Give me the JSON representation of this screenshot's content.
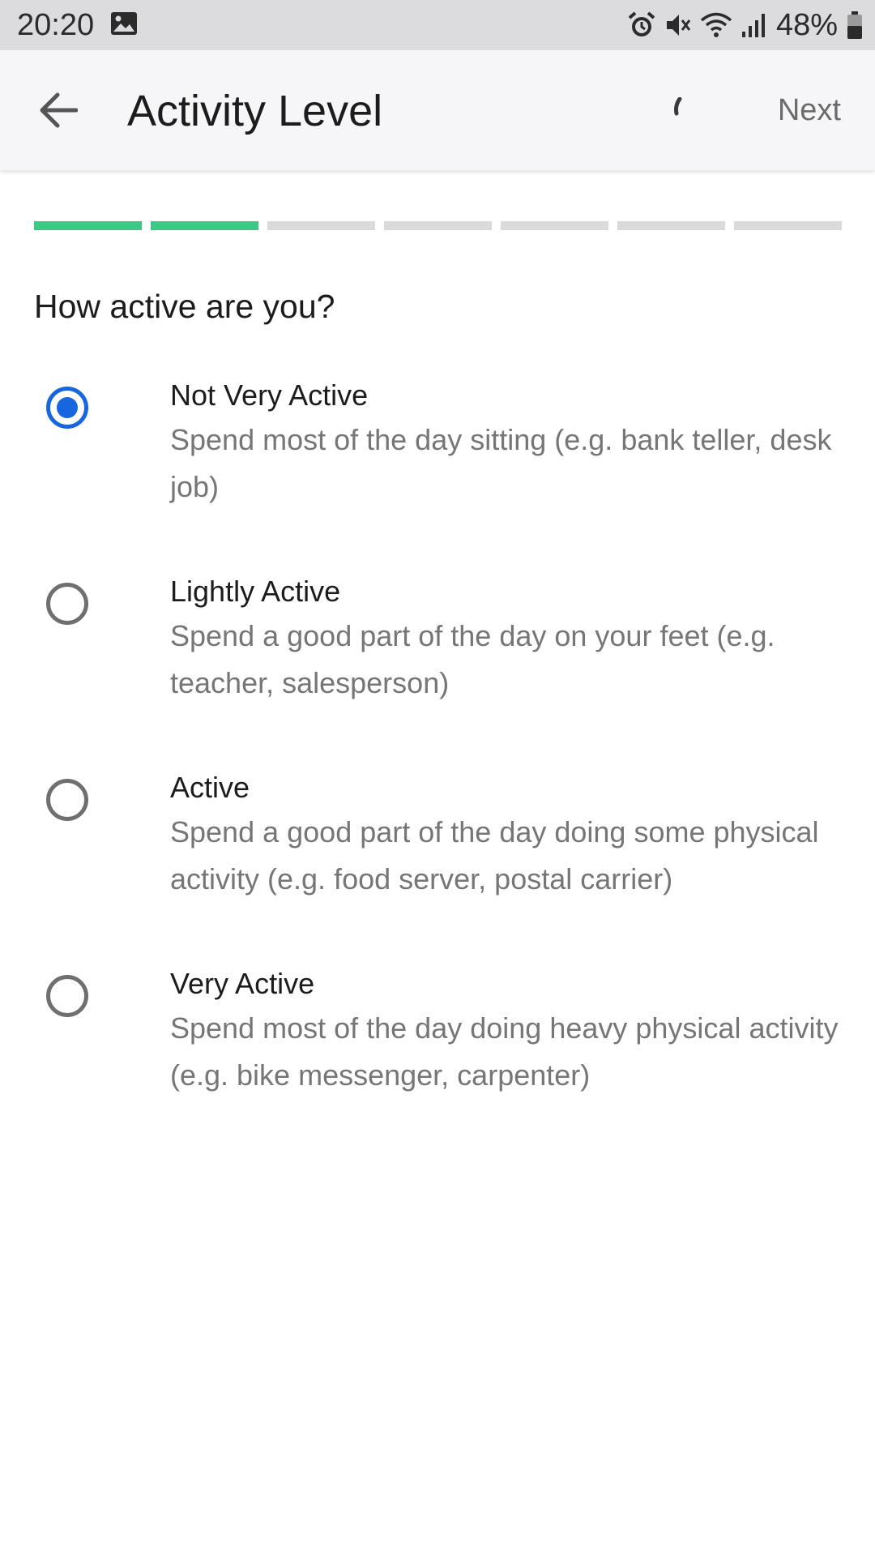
{
  "status_bar": {
    "time": "20:20",
    "battery": "48%",
    "icons": [
      "gallery-icon",
      "alarm-icon",
      "mute-icon",
      "wifi-icon",
      "signal-icon",
      "battery-icon"
    ]
  },
  "app_bar": {
    "title": "Activity Level",
    "next_label": "Next"
  },
  "progress": {
    "total_steps": 7,
    "completed_steps": 2,
    "done_color": "#3ec886",
    "pending_color": "#dadada"
  },
  "question": "How active are you?",
  "options": [
    {
      "title": "Not Very Active",
      "description": "Spend most of the day sitting (e.g. bank teller, desk job)",
      "selected": true
    },
    {
      "title": "Lightly Active",
      "description": "Spend a good part of the day on your feet (e.g. teacher, salesperson)",
      "selected": false
    },
    {
      "title": "Active",
      "description": "Spend a good part of the day doing some physical activity (e.g. food server, postal carrier)",
      "selected": false
    },
    {
      "title": "Very Active",
      "description": "Spend most of the day doing heavy physical activity (e.g. bike messenger, carpenter)",
      "selected": false
    }
  ],
  "colors": {
    "accent": "#1766e0",
    "progress_done": "#3ec886"
  }
}
